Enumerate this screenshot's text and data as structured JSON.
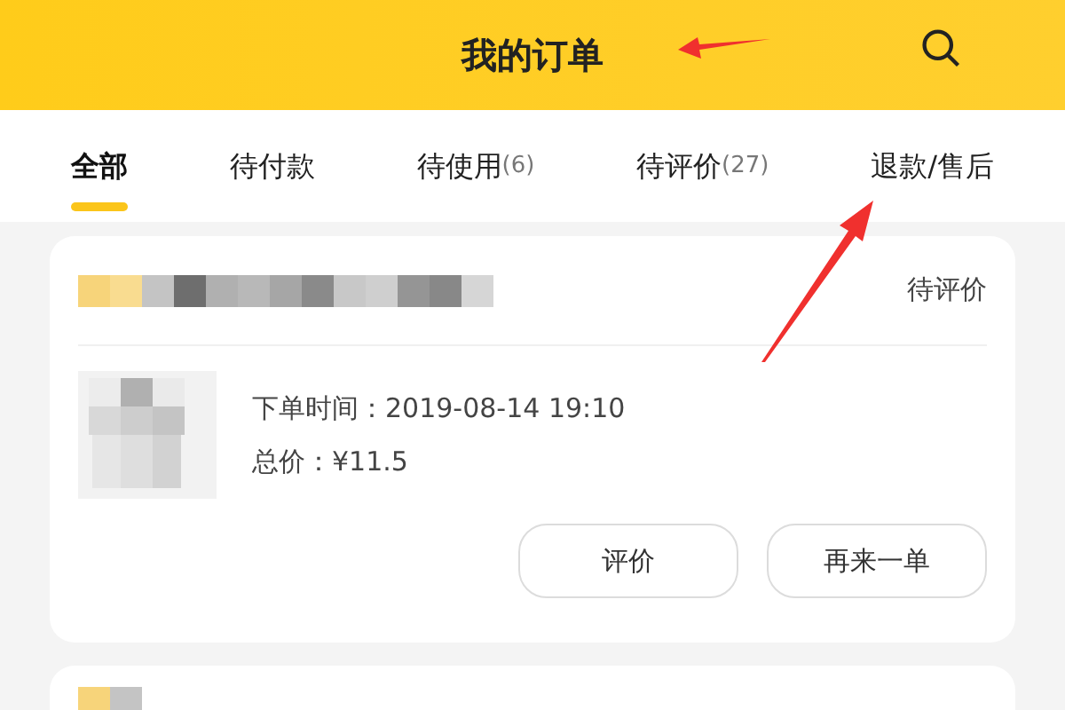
{
  "header": {
    "title": "我的订单"
  },
  "tabs": [
    {
      "label": "全部",
      "selected": true
    },
    {
      "label": "待付款",
      "selected": false
    },
    {
      "label": "待使用",
      "count": "(6)",
      "selected": false
    },
    {
      "label": "待评价",
      "count": "(27)",
      "selected": false
    },
    {
      "label": "退款/售后",
      "selected": false
    }
  ],
  "orders": [
    {
      "status": "待评价",
      "order_time": "下单时间：2019-08-14 19:10",
      "total": "总价：¥11.5",
      "buttons": [
        "评价",
        "再来一单"
      ]
    }
  ]
}
